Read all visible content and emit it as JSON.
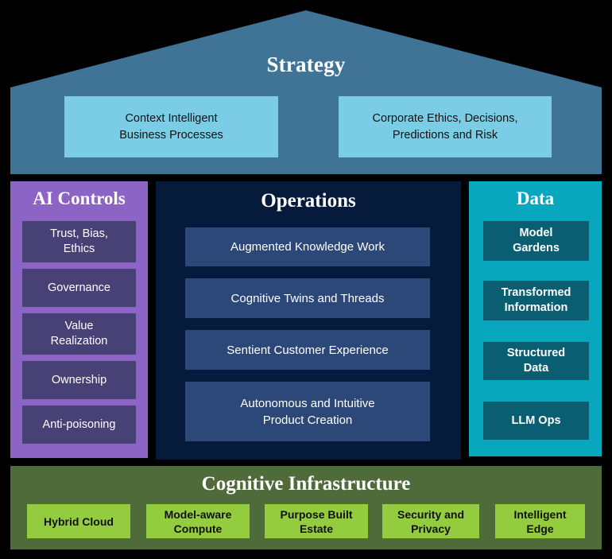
{
  "colors": {
    "background": "#000000",
    "roof": "#3F7496",
    "strategy_box": "#7ACDE5",
    "ai_controls_panel": "#8C64C6",
    "ai_controls_cell": "#474175",
    "operations_panel": "#061A3B",
    "operations_cell": "#2C4878",
    "data_panel": "#09A7BD",
    "data_cell": "#0A5E72",
    "infrastructure_panel": "#4E6B39",
    "infrastructure_cell": "#93CC3F",
    "text_light": "#FFFFFF",
    "text_dark": "#111111"
  },
  "strategy": {
    "title": "Strategy",
    "boxes": [
      {
        "label": "Context Intelligent\nBusiness Processes"
      },
      {
        "label": "Corporate Ethics, Decisions,\nPredictions and Risk"
      }
    ]
  },
  "ai_controls": {
    "title": "AI Controls",
    "items": [
      {
        "label": "Trust, Bias,\nEthics"
      },
      {
        "label": "Governance"
      },
      {
        "label": "Value\nRealization"
      },
      {
        "label": "Ownership"
      },
      {
        "label": "Anti-poisoning"
      }
    ]
  },
  "operations": {
    "title": "Operations",
    "items": [
      {
        "label": "Augmented Knowledge Work"
      },
      {
        "label": "Cognitive Twins and Threads"
      },
      {
        "label": "Sentient Customer Experience"
      },
      {
        "label": "Autonomous and Intuitive\nProduct Creation"
      }
    ]
  },
  "data_pillar": {
    "title": "Data",
    "items": [
      {
        "label": "Model\nGardens"
      },
      {
        "label": "Transformed\nInformation"
      },
      {
        "label": "Structured\nData"
      },
      {
        "label": "LLM Ops"
      }
    ]
  },
  "infrastructure": {
    "title": "Cognitive Infrastructure",
    "items": [
      {
        "label": "Hybrid Cloud"
      },
      {
        "label": "Model-aware\nCompute"
      },
      {
        "label": "Purpose Built\nEstate"
      },
      {
        "label": "Security and\nPrivacy"
      },
      {
        "label": "Intelligent\nEdge"
      }
    ]
  }
}
